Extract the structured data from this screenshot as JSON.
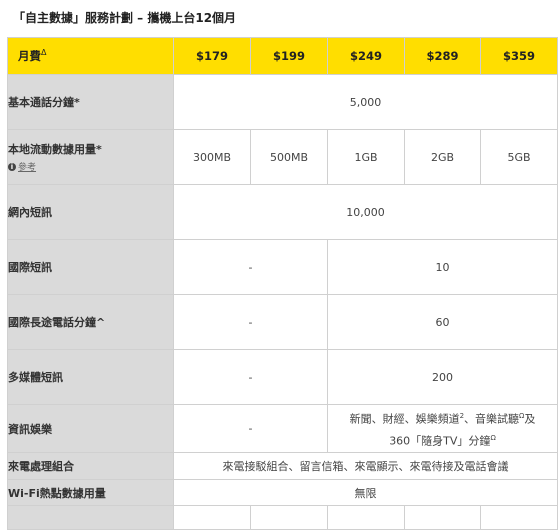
{
  "title": "「自主數據」服務計劃 – 攜機上台12個月",
  "header": {
    "label": "月費",
    "label_sup": "Δ",
    "prices": [
      "$179",
      "$199",
      "$249",
      "$289",
      "$359"
    ]
  },
  "rows": {
    "basic_voice": {
      "label": "基本通話分鐘*",
      "value": "5,000"
    },
    "local_data": {
      "label": "本地流動數據用量*",
      "ref_label": "參考",
      "values": [
        "300MB",
        "500MB",
        "1GB",
        "2GB",
        "5GB"
      ]
    },
    "intra_sms": {
      "label": "網內短訊",
      "value": "10,000"
    },
    "idd_sms": {
      "label": "國際短訊",
      "left": "-",
      "right": "10"
    },
    "idd_minutes": {
      "label": "國際長途電話分鐘^",
      "left": "-",
      "right": "60"
    },
    "mms": {
      "label": "多媒體短訊",
      "left": "-",
      "right": "200"
    },
    "infotainment": {
      "label": "資訊娛樂",
      "left": "-",
      "line1_a": "新聞、財經、娛樂頻道",
      "line1_sup1": "2",
      "line1_b": "、音樂試聽",
      "line1_sup2": "Ω",
      "line1_c": "及",
      "line2_a": "360「隨身TV」分鐘",
      "line2_sup": "Ω"
    },
    "call_mgmt": {
      "label": "來電處理組合",
      "value": "來電接駁組合、留言信箱、來電顯示、來電待接及電話會議"
    },
    "wifi_data": {
      "label": "Wi-Fi熱點數據用量",
      "value": "無限"
    }
  },
  "colors": {
    "header_bg": "#ffde00",
    "label_bg": "#dadada",
    "border": "#d0d0d0"
  }
}
